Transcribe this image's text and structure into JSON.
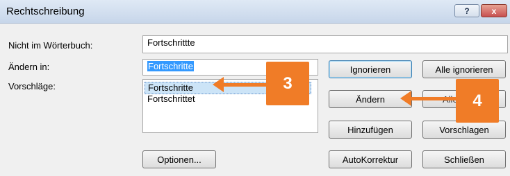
{
  "window": {
    "title": "Rechtschreibung",
    "help_label": "?",
    "close_label": "x"
  },
  "labels": {
    "not_in_dict": "Nicht im Wörterbuch:",
    "change_to": "Ändern in:",
    "suggestions": "Vorschläge:"
  },
  "fields": {
    "not_in_dict_value": "Fortschrittte",
    "change_to_value": "Fortschritte"
  },
  "suggestions": [
    "Fortschritte",
    "Fortschrittet"
  ],
  "buttons": {
    "ignore": "Ignorieren",
    "ignore_all": "Alle ignorieren",
    "change": "Ändern",
    "change_all": "Alle",
    "add": "Hinzufügen",
    "suggest": "Vorschlagen",
    "options": "Optionen...",
    "autocorrect": "AutoKorrektur",
    "close": "Schließen"
  },
  "callouts": {
    "first": "3",
    "second": "4"
  },
  "colors": {
    "accent": "#f07c27",
    "selection": "#3399ff"
  }
}
